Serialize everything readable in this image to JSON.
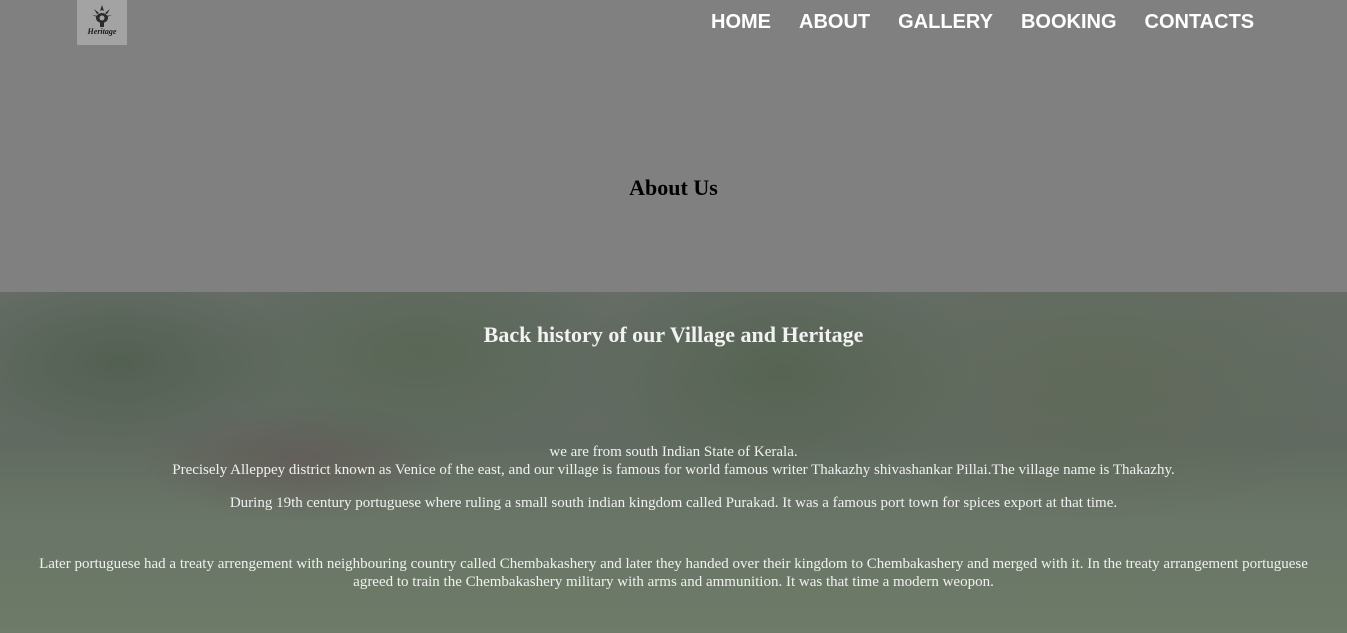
{
  "logo": {
    "text": "Heritage",
    "icon": "crest-icon"
  },
  "nav": [
    {
      "label": "HOME"
    },
    {
      "label": "ABOUT"
    },
    {
      "label": "GALLERY"
    },
    {
      "label": "BOOKING"
    },
    {
      "label": "CONTACTS"
    }
  ],
  "page_title": "About Us",
  "hero": {
    "heading": "Back history of our Village and Heritage",
    "para1_line1": "we are from south Indian State of Kerala.",
    "para1_line2": "Precisely Alleppey district known as Venice of the east, and our village is famous for world famous writer Thakazhy shivashankar Pillai.The village name is Thakazhy.",
    "para2": "During 19th century portuguese where ruling a small south indian kingdom called Purakad. It was a famous port town for spices export at that time.",
    "para3": "Later portuguese had a treaty arrengement with neighbouring country called Chembakashery and later they handed over their kingdom to Chembakashery and merged with it. In the treaty arrangement portuguese agreed to train the Chembakashery military with arms and ammunition. It was that time a modern weopon."
  },
  "colors": {
    "header_bg": "#808080",
    "nav_text": "#ffffff"
  }
}
